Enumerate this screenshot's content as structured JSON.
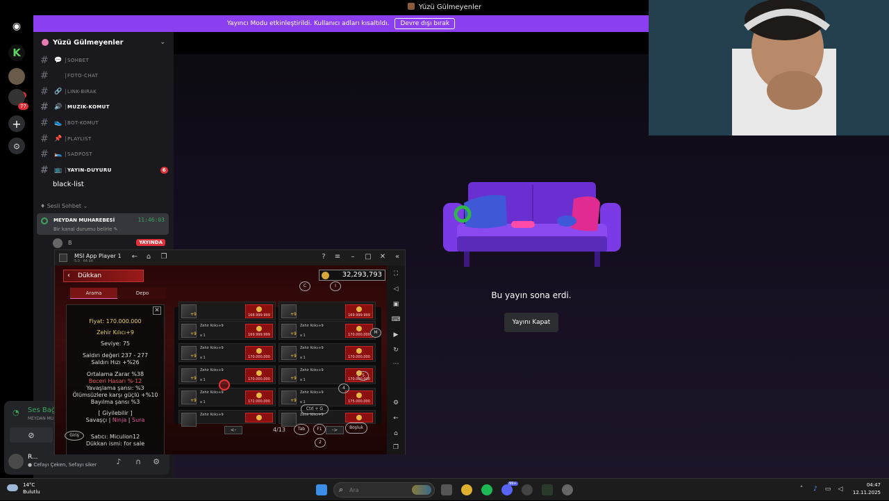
{
  "window": {
    "title": "Yüzü Gülmeyenler"
  },
  "streamer_bar": {
    "text": "Yayıncı Modu etkinleştirildi. Kullanıcı adları kısaltıldı.",
    "button": "Devre dışı bırak"
  },
  "rail": {
    "badge_1": "6",
    "badge_2": "77"
  },
  "server": {
    "name": "Yüzü Gülmeyenler",
    "channels": [
      {
        "emoji": "💬",
        "label": "SOHBET"
      },
      {
        "emoji": "",
        "label": "FOTO-CHAT"
      },
      {
        "emoji": "🔗",
        "label": "LINK-BIRAK"
      },
      {
        "emoji": "🔊",
        "label": "MUZIK-KOMUT",
        "bright": true
      },
      {
        "emoji": "👟",
        "label": "BOT-KOMUT"
      },
      {
        "emoji": "📌",
        "label": "PLAYLIST"
      },
      {
        "emoji": "🛌",
        "label": "SADPOST"
      },
      {
        "emoji": "📺",
        "label": "YAYIN-DUYURU",
        "bright": true,
        "badge": "6"
      }
    ],
    "black_list": "black-list",
    "voice_category": "♦ Sesli Sohbet ⌄",
    "voice_channel": {
      "name": "MEYDAN MUHAREBESİ",
      "time": "11:46:03",
      "status": "Bir kanal durumu belirle ✎"
    },
    "voice_user": {
      "name": "B",
      "live": "YAYINDA"
    }
  },
  "user_panel": {
    "connection": "Ses Bağl",
    "sub": "MEYDAN MU",
    "name": "R...",
    "status": "● Cefayı Çeken, Sefayı siker"
  },
  "main": {
    "ended_text": "Bu yayın sona erdi.",
    "close_button": "Yayını Kapat"
  },
  "msi": {
    "title": "MSI App Player 1",
    "subtitle": "5.0 · 64 bit",
    "shop_title": "Dükkan",
    "coins": "32,293,793",
    "tabs": [
      "Arama",
      "Depo"
    ],
    "tooltip": {
      "price": "Fiyat: 170.000.000",
      "item": "Zehir Kılıcı+9",
      "level": "Seviye: 75",
      "attack": "Saldırı değeri 237 - 277",
      "speed": "Saldırı Hızı +%26",
      "avg": "Ortalama Zarar %38",
      "skill": "Beceri Hasarı %-12",
      "slow": "Yavaşlama şansı: %3",
      "undead": "Ölümsüzlere karşı güçlü +%10",
      "faint": "Bayılma şansı %3",
      "wearable": "[ Giyilebilir ]",
      "classes_1": "Savaşçı",
      "classes_2": "Ninja",
      "classes_3": "Sura",
      "seller": "Satıcı: Miculion12",
      "shop": "Dükkan ismi: for sale"
    },
    "grid": [
      {
        "name": "",
        "qty": "",
        "price": "168.999.999",
        "plus": "+9"
      },
      {
        "name": "",
        "qty": "",
        "price": "169.999.999",
        "plus": "+9"
      },
      {
        "name": "Zehir Kılıcı+9",
        "qty": "x 1",
        "price": "169.999.999",
        "plus": "+9"
      },
      {
        "name": "Zehir Kılıcı+9",
        "qty": "x 1",
        "price": "170.000.000",
        "plus": "+9"
      },
      {
        "name": "Zehir Kılıcı+9",
        "qty": "x 1",
        "price": "170.000.000",
        "plus": "+9"
      },
      {
        "name": "Zehir Kılıcı+9",
        "qty": "x 1",
        "price": "170.000.000",
        "plus": "+9"
      },
      {
        "name": "Zehir Kılıcı+9",
        "qty": "x 1",
        "price": "170.000.000",
        "plus": "+9"
      },
      {
        "name": "Zehir Kılıcı+9",
        "qty": "x 1",
        "price": "170.000.000",
        "plus": "+9"
      },
      {
        "name": "Zehir Kılıcı+9",
        "qty": "x 1",
        "price": "172.000.000",
        "plus": "+9"
      },
      {
        "name": "Zehir Kılıcı+9",
        "qty": "x 1",
        "price": "175.000.000",
        "plus": "+9"
      },
      {
        "name": "Zehir Kılıcı+9",
        "qty": "",
        "price": "",
        "plus": ""
      },
      {
        "name": "Zehir Kılıcı+9",
        "qty": "",
        "price": "",
        "plus": ""
      }
    ],
    "page": "4/13",
    "prev": "<-",
    "next": "->",
    "keys": {
      "c": "C",
      "i": "I",
      "m": "M",
      "k4": "4",
      "k5": "5",
      "k3": "3",
      "ctrl_g": "Ctrl + G",
      "tab": "Tab",
      "f1": "F1",
      "space": "Boşluk",
      "k2": "2",
      "enter": "Giriş"
    }
  },
  "taskbar": {
    "temp": "14°C",
    "condition": "Bulutlu",
    "search_placeholder": "Ara",
    "time": "04:47",
    "date": "12.11.2025",
    "discord_badge": "99+"
  }
}
